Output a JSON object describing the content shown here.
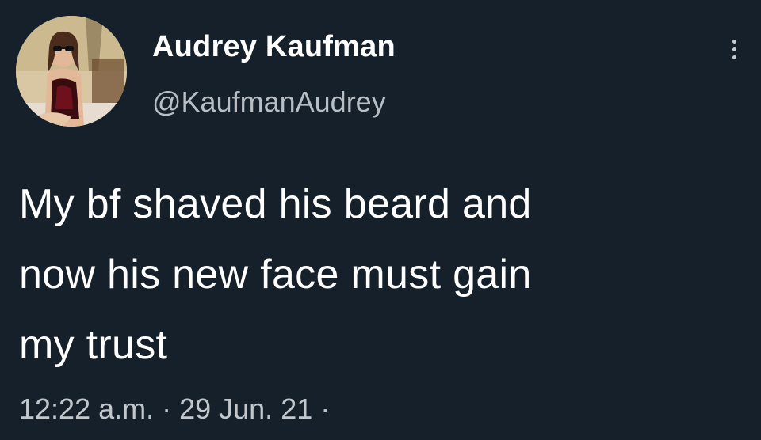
{
  "tweet": {
    "author": {
      "display_name": "Audrey Kaufman",
      "handle": "@KaufmanAudrey",
      "avatar_icon": "profile-photo"
    },
    "more_icon": "vertical-ellipsis-icon",
    "text": "My bf shaved his beard and\nnow his new face must gain\nmy trust",
    "meta": "12:22 a.m. · 29 Jun. 21 ·"
  },
  "colors": {
    "background": "#15202b",
    "primary_text": "#ffffff",
    "secondary_text": "#b8bec4"
  }
}
